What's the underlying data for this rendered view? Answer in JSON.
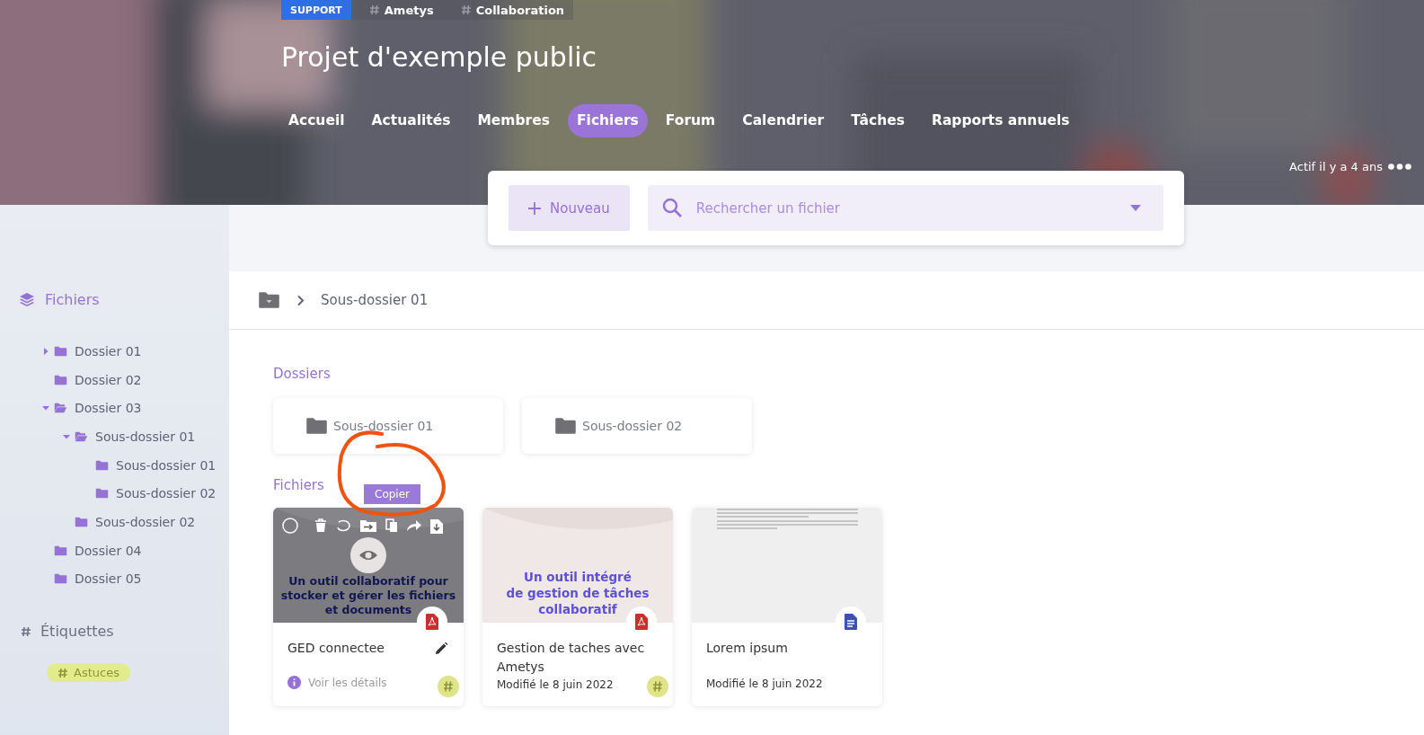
{
  "header": {
    "tags": [
      {
        "kind": "badge",
        "label": "SUPPORT"
      },
      {
        "kind": "hashtag",
        "label": "Ametys"
      },
      {
        "kind": "hashtag",
        "label": "Collaboration"
      }
    ],
    "title": "Projet d'exemple public",
    "nav": [
      {
        "label": "Accueil",
        "selected": false
      },
      {
        "label": "Actualités",
        "selected": false
      },
      {
        "label": "Membres",
        "selected": false
      },
      {
        "label": "Fichiers",
        "selected": true
      },
      {
        "label": "Forum",
        "selected": false
      },
      {
        "label": "Calendrier",
        "selected": false
      },
      {
        "label": "Tâches",
        "selected": false
      },
      {
        "label": "Rapports annuels",
        "selected": false
      }
    ],
    "activity": "Actif il y a 4 ans"
  },
  "toolbar": {
    "new_button": "Nouveau",
    "search": {
      "placeholder": "Rechercher un fichier"
    }
  },
  "sidebar": {
    "title": "Fichiers",
    "tree": [
      {
        "label": "Dossier 01",
        "expanded": false
      },
      {
        "label": "Dossier 02"
      },
      {
        "label": "Dossier 03",
        "expanded": true,
        "children": [
          {
            "label": "Sous-dossier 01",
            "expanded": true,
            "children": [
              {
                "label": "Sous-dossier 01"
              },
              {
                "label": "Sous-dossier 02"
              }
            ]
          },
          {
            "label": "Sous-dossier 02"
          }
        ]
      },
      {
        "label": "Dossier 04"
      },
      {
        "label": "Dossier 05"
      }
    ],
    "tags_title": "Étiquettes",
    "tags": [
      "Astuces"
    ]
  },
  "main": {
    "breadcrumb": [
      "Sous-dossier 01"
    ],
    "folders_title": "Dossiers",
    "folders": [
      "Sous-dossier 01",
      "Sous-dossier 02"
    ],
    "files_title": "Fichiers",
    "files": [
      {
        "name": "GED connectee",
        "kind": "pdf",
        "preview": {
          "kind": "slide",
          "text": "Un outil collaboratif pour\nstocker et gérer les fichiers\net documents"
        },
        "hovered": true,
        "tooltip": "Copier",
        "details_link": "Voir les détails",
        "tagged": true
      },
      {
        "name": "Gestion de taches avec Ametys",
        "kind": "pdf",
        "preview": {
          "kind": "slide",
          "text": "Un outil intégré\nde gestion de tâches\ncollaboratif"
        },
        "hovered": false,
        "modified": "Modifié le 8 juin 2022",
        "tagged": true
      },
      {
        "name": "Lorem ipsum",
        "kind": "doc",
        "preview": {
          "kind": "document"
        },
        "hovered": false,
        "modified": "Modifié le 8 juin 2022",
        "tagged": false
      }
    ]
  }
}
